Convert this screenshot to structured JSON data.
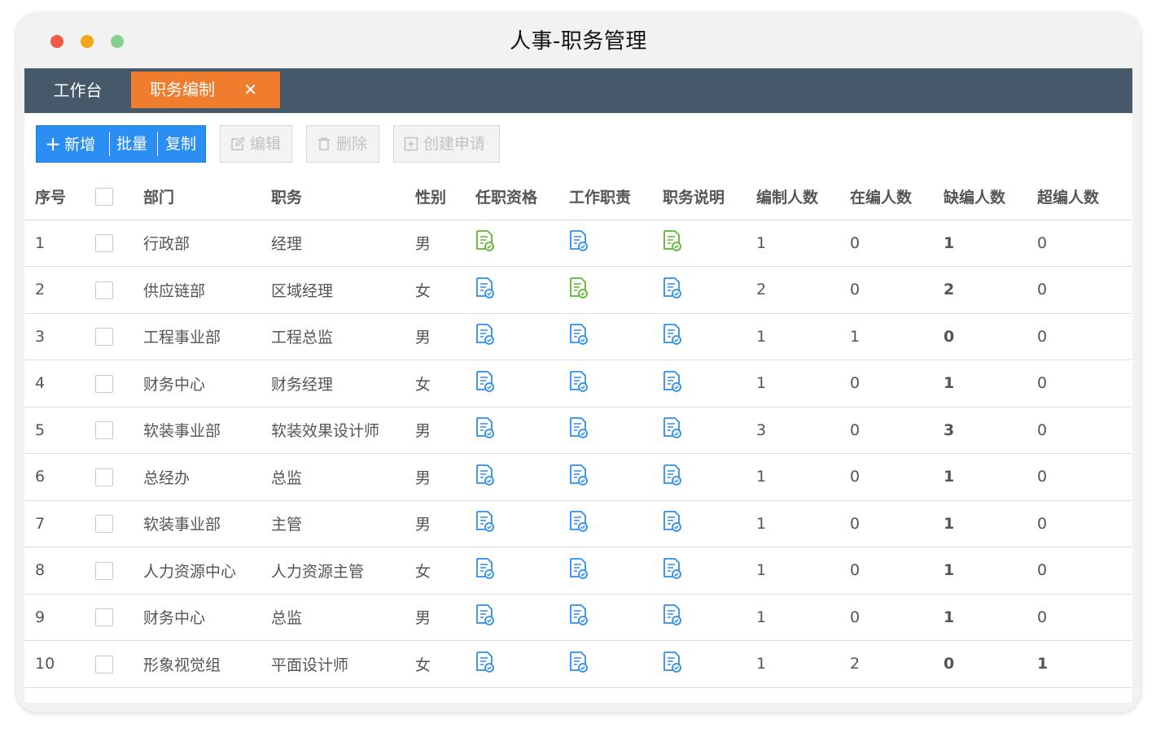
{
  "window": {
    "title": "人事-职务管理"
  },
  "tabs": {
    "home": "工作台",
    "active": "职务编制",
    "close": "✕"
  },
  "toolbar": {
    "add": "新增",
    "batch": "批量",
    "copy": "复制",
    "edit": "编辑",
    "delete": "删除",
    "apply": "创建申请"
  },
  "table": {
    "headers": [
      "序号",
      "部门",
      "职务",
      "性别",
      "任职资格",
      "工作职责",
      "职务说明",
      "编制人数",
      "在编人数",
      "缺编人数",
      "超编人数"
    ],
    "rows": [
      {
        "no": "1",
        "dept": "行政部",
        "post": "经理",
        "gender": "男",
        "qual": "green",
        "duty": "blue",
        "desc": "green",
        "quota": "1",
        "actual": "0",
        "lack": "1",
        "over": "0"
      },
      {
        "no": "2",
        "dept": "供应链部",
        "post": "区域经理",
        "gender": "女",
        "qual": "blue",
        "duty": "green",
        "desc": "blue",
        "quota": "2",
        "actual": "0",
        "lack": "2",
        "over": "0"
      },
      {
        "no": "3",
        "dept": "工程事业部",
        "post": "工程总监",
        "gender": "男",
        "qual": "blue",
        "duty": "blue",
        "desc": "blue",
        "quota": "1",
        "actual": "1",
        "lack": "0",
        "over": "0"
      },
      {
        "no": "4",
        "dept": "财务中心",
        "post": "财务经理",
        "gender": "女",
        "qual": "blue",
        "duty": "blue",
        "desc": "blue",
        "quota": "1",
        "actual": "0",
        "lack": "1",
        "over": "0"
      },
      {
        "no": "5",
        "dept": "软装事业部",
        "post": "软装效果设计师",
        "gender": "男",
        "qual": "blue",
        "duty": "blue",
        "desc": "blue",
        "quota": "3",
        "actual": "0",
        "lack": "3",
        "over": "0"
      },
      {
        "no": "6",
        "dept": "总经办",
        "post": "总监",
        "gender": "男",
        "qual": "blue",
        "duty": "blue",
        "desc": "blue",
        "quota": "1",
        "actual": "0",
        "lack": "1",
        "over": "0"
      },
      {
        "no": "7",
        "dept": "软装事业部",
        "post": "主管",
        "gender": "男",
        "qual": "blue",
        "duty": "blue",
        "desc": "blue",
        "quota": "1",
        "actual": "0",
        "lack": "1",
        "over": "0"
      },
      {
        "no": "8",
        "dept": "人力资源中心",
        "post": "人力资源主管",
        "gender": "女",
        "qual": "blue",
        "duty": "blue",
        "desc": "blue",
        "quota": "1",
        "actual": "0",
        "lack": "1",
        "over": "0"
      },
      {
        "no": "9",
        "dept": "财务中心",
        "post": "总监",
        "gender": "男",
        "qual": "blue",
        "duty": "blue",
        "desc": "blue",
        "quota": "1",
        "actual": "0",
        "lack": "1",
        "over": "0"
      },
      {
        "no": "10",
        "dept": "形象视觉组",
        "post": "平面设计师",
        "gender": "女",
        "qual": "blue",
        "duty": "blue",
        "desc": "blue",
        "quota": "1",
        "actual": "2",
        "lack": "0",
        "over": "1"
      }
    ]
  },
  "colors": {
    "tabbar": "#46596a",
    "active_tab": "#f07d2d",
    "primary_button": "#2b8ef2",
    "icon_blue": "#2b8ef2",
    "icon_green": "#5cb531",
    "alert_red": "#e8171b"
  }
}
